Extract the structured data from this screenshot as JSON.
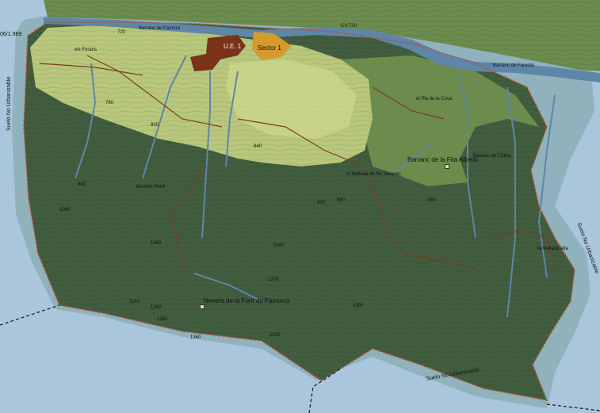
{
  "map": {
    "colors": {
      "water": "#a9c6dc",
      "buffer": "#8fb2bd",
      "dark_forest": "#3f5a3c",
      "mid_green": "#6b8c4c",
      "light_green": "#b8c77c",
      "pale_green": "#cfd98f",
      "ue_brown": "#7a3218",
      "sector_orange": "#d59a2c",
      "river": "#5e86a8",
      "boundary": "#b8503a"
    },
    "labels": {
      "date_fragment": "06/1.989",
      "suelo_left": "Suelo No Urbanizable",
      "suelo_right": "Suelo No Urbanizable",
      "suelo_bottom": "Suelo No Urbanizable",
      "els_forans": "els Forans",
      "ue1": "U.E. 1",
      "sector1": "Sector 1",
      "barranc_farnera": "Barranc de Farnera",
      "cv": "CV-720",
      "barranc_faraclis": "Barranc de Faraclis",
      "pla_cova": "el Pla de la Cova",
      "barranc_fita": "Barranc de la Fita Alberic",
      "barranc_oliva": "Barranc de l Oliva",
      "mallada_saveres": "la Mallada de les Saveres",
      "barranc_petot": "Barranc Petot",
      "mallada_alta": "la Mallada Alta",
      "nevera": "Nevera de la Font de Famorca"
    },
    "contour_values": [
      "720",
      "760",
      "800",
      "840",
      "880",
      "920",
      "960",
      "980",
      "1000",
      "1040",
      "1080",
      "1160",
      "1200",
      "1240",
      "1280",
      "1300",
      "1320",
      "1360"
    ]
  }
}
